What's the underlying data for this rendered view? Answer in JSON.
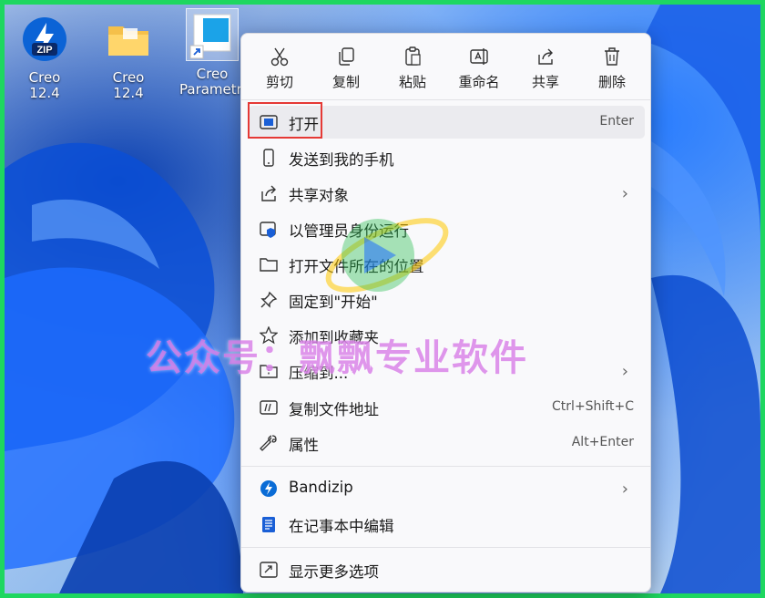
{
  "desktop": {
    "icons": [
      {
        "label": "Creo 12.4",
        "icon": "zip-archive-icon"
      },
      {
        "label": "Creo 12.4",
        "icon": "folder-icon"
      },
      {
        "label": "Creo Parametr...",
        "icon": "shortcut-app-icon"
      }
    ]
  },
  "context_menu": {
    "toolbar": [
      {
        "label": "剪切",
        "icon": "scissors-icon"
      },
      {
        "label": "复制",
        "icon": "copy-icon"
      },
      {
        "label": "粘贴",
        "icon": "paste-icon"
      },
      {
        "label": "重命名",
        "icon": "rename-icon"
      },
      {
        "label": "共享",
        "icon": "share-icon"
      },
      {
        "label": "删除",
        "icon": "trash-icon"
      }
    ],
    "items": [
      {
        "label": "打开",
        "shortcut": "Enter"
      },
      {
        "label": "发送到我的手机"
      },
      {
        "label": "共享对象",
        "submenu": true
      },
      {
        "label": "以管理员身份运行"
      },
      {
        "label": "打开文件所在的位置"
      },
      {
        "label": "固定到\"开始\""
      },
      {
        "label": "添加到收藏夹"
      },
      {
        "label": "压缩到...",
        "submenu": true
      },
      {
        "label": "复制文件地址",
        "shortcut": "Ctrl+Shift+C"
      },
      {
        "label": "属性",
        "shortcut": "Alt+Enter"
      },
      {
        "label": "Bandizip",
        "submenu": true
      },
      {
        "label": "在记事本中编辑"
      },
      {
        "label": "显示更多选项"
      }
    ],
    "submenu_glyph": "›"
  },
  "watermark": {
    "text": "公众号：飘飘专业软件"
  },
  "colors": {
    "frame": "#1ed760",
    "highlight": "#e53935",
    "accent": "#0a6cd6"
  }
}
